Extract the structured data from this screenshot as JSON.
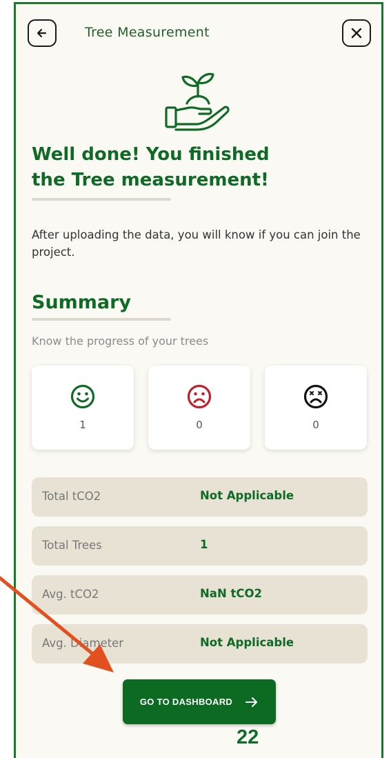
{
  "header": {
    "title": "Tree Measurement",
    "back_icon": "arrow-left-icon",
    "close_icon": "close-icon"
  },
  "hero": {
    "icon": "hand-holding-plant-icon",
    "headline_line1": "Well done! You finished",
    "headline_line2": "the Tree measurement!"
  },
  "description": "After uploading the data, you will know if you can join the project.",
  "summary": {
    "title": "Summary",
    "subtitle": "Know the progress of your trees",
    "cards": [
      {
        "icon": "happy-face-icon",
        "count": "1",
        "color": "#0f6a25"
      },
      {
        "icon": "sad-face-icon",
        "count": "0",
        "color": "#c0202b"
      },
      {
        "icon": "dead-face-icon",
        "count": "0",
        "color": "#111111"
      }
    ]
  },
  "stats": [
    {
      "label": "Total tCO2",
      "value": "Not Applicable"
    },
    {
      "label": "Total Trees",
      "value": "1"
    },
    {
      "label": "Avg. tCO2",
      "value": "NaN tCO2"
    },
    {
      "label": "Avg. Diameter",
      "value": "Not Applicable"
    }
  ],
  "footer": {
    "button_label": "GO TO DASHBOARD",
    "button_icon": "arrow-right-icon",
    "step_number": "22"
  },
  "colors": {
    "primary": "#0f6a25",
    "annotation_arrow": "#e2501f"
  }
}
